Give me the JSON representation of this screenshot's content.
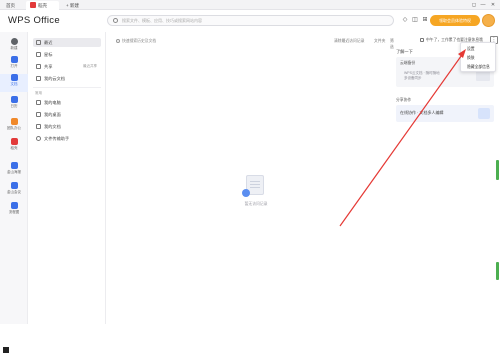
{
  "tabs": {
    "home": "首页",
    "active": "稻壳",
    "new": "+ 新建"
  },
  "window_controls": [
    "◻",
    "—",
    "✕"
  ],
  "header": {
    "logo": "WPS Office",
    "search_placeholder": "搜索文件、模板、应用、技巧或搜索网站内容",
    "vip_label": "领取会员体验特权"
  },
  "rail": [
    {
      "label": "新建",
      "icon": "plus-icon",
      "color": "#5f6368"
    },
    {
      "label": "打开",
      "icon": "folder-icon",
      "color": "#3b6fe8"
    },
    {
      "label": "文档",
      "icon": "document-icon",
      "color": "#3b6fe8"
    },
    {
      "label": "日历",
      "icon": "calendar-icon",
      "color": "#3b6fe8"
    },
    {
      "label": "团队办公",
      "icon": "team-icon",
      "color": "#f0892b"
    },
    {
      "label": "稻壳",
      "icon": "daoke-icon",
      "color": "#e23a3a"
    },
    {
      "label": "金山海报",
      "icon": "poster-icon",
      "color": "#3b6fe8"
    },
    {
      "label": "金山会议",
      "icon": "meeting-icon",
      "color": "#3b6fe8"
    },
    {
      "label": "流程图",
      "icon": "flowchart-icon",
      "color": "#3b6fe8"
    }
  ],
  "sidebar": {
    "items": [
      {
        "label": "最近",
        "meta": ""
      },
      {
        "label": "星标",
        "meta": ""
      },
      {
        "label": "共享",
        "meta": "最近共享"
      },
      {
        "label": "我的云文档",
        "meta": ""
      }
    ],
    "group_label": "常用",
    "group_items": [
      {
        "label": "我的电脑"
      },
      {
        "label": "我的桌面"
      },
      {
        "label": "我的文档"
      },
      {
        "label": "文件传输助手"
      }
    ]
  },
  "main": {
    "hint": "快速搜索历史及文档",
    "toolbar_right": [
      "清除最近访问记录",
      "文件夹",
      "筛选"
    ],
    "empty_text": "暂无访问记录"
  },
  "right_panel": {
    "top_text": "中午了，工作累了也要注意休息哦",
    "title": "了解一下",
    "card_title": "云端备份",
    "card_sub_1": "WPS云文档 · 随时随地",
    "card_sub_2": "多设备同步",
    "section": "分享协作",
    "card2_title": "在线协作 · 文档多人编辑"
  },
  "menu": {
    "items": [
      "设置",
      "换肤",
      "隐藏全部信息"
    ]
  }
}
